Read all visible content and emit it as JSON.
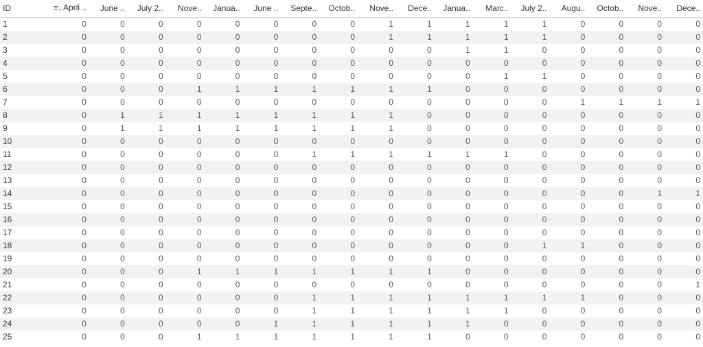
{
  "chart_data": {
    "type": "table",
    "title": "",
    "id_header": "ID",
    "columns": [
      "April ..",
      "June ..",
      "July 2..",
      "Nove..",
      "Janua..",
      "June ..",
      "Septe..",
      "Octob..",
      "Nove..",
      "Dece..",
      "Janua..",
      "Marc..",
      "July 2..",
      "Augu..",
      "Octob..",
      "Nove..",
      "Dece.."
    ],
    "sorted_column_index": 0,
    "rows": [
      {
        "id": "1",
        "values": [
          0,
          0,
          0,
          0,
          0,
          0,
          0,
          0,
          1,
          1,
          1,
          1,
          1,
          0,
          0,
          0,
          0
        ]
      },
      {
        "id": "2",
        "values": [
          0,
          0,
          0,
          0,
          0,
          0,
          0,
          0,
          1,
          1,
          1,
          1,
          1,
          0,
          0,
          0,
          0
        ]
      },
      {
        "id": "3",
        "values": [
          0,
          0,
          0,
          0,
          0,
          0,
          0,
          0,
          0,
          0,
          1,
          1,
          0,
          0,
          0,
          0,
          0
        ]
      },
      {
        "id": "4",
        "values": [
          0,
          0,
          0,
          0,
          0,
          0,
          0,
          0,
          0,
          0,
          0,
          0,
          0,
          0,
          0,
          0,
          0
        ]
      },
      {
        "id": "5",
        "values": [
          0,
          0,
          0,
          0,
          0,
          0,
          0,
          0,
          0,
          0,
          0,
          1,
          1,
          0,
          0,
          0,
          0
        ]
      },
      {
        "id": "6",
        "values": [
          0,
          0,
          0,
          1,
          1,
          1,
          1,
          1,
          1,
          1,
          0,
          0,
          0,
          0,
          0,
          0,
          0
        ]
      },
      {
        "id": "7",
        "values": [
          0,
          0,
          0,
          0,
          0,
          0,
          0,
          0,
          0,
          0,
          0,
          0,
          0,
          1,
          1,
          1,
          1
        ]
      },
      {
        "id": "8",
        "values": [
          0,
          1,
          1,
          1,
          1,
          1,
          1,
          1,
          1,
          0,
          0,
          0,
          0,
          0,
          0,
          0,
          0
        ]
      },
      {
        "id": "9",
        "values": [
          0,
          1,
          1,
          1,
          1,
          1,
          1,
          1,
          1,
          0,
          0,
          0,
          0,
          0,
          0,
          0,
          0
        ]
      },
      {
        "id": "10",
        "values": [
          0,
          0,
          0,
          0,
          0,
          0,
          0,
          0,
          0,
          0,
          0,
          0,
          0,
          0,
          0,
          0,
          0
        ]
      },
      {
        "id": "11",
        "values": [
          0,
          0,
          0,
          0,
          0,
          0,
          1,
          1,
          1,
          1,
          1,
          1,
          0,
          0,
          0,
          0,
          0
        ]
      },
      {
        "id": "12",
        "values": [
          0,
          0,
          0,
          0,
          0,
          0,
          0,
          0,
          0,
          0,
          0,
          0,
          0,
          0,
          0,
          0,
          0
        ]
      },
      {
        "id": "13",
        "values": [
          0,
          0,
          0,
          0,
          0,
          0,
          0,
          0,
          0,
          0,
          0,
          0,
          0,
          0,
          0,
          0,
          0
        ]
      },
      {
        "id": "14",
        "values": [
          0,
          0,
          0,
          0,
          0,
          0,
          0,
          0,
          0,
          0,
          0,
          0,
          0,
          0,
          0,
          1,
          1
        ]
      },
      {
        "id": "15",
        "values": [
          0,
          0,
          0,
          0,
          0,
          0,
          0,
          0,
          0,
          0,
          0,
          0,
          0,
          0,
          0,
          0,
          0
        ]
      },
      {
        "id": "16",
        "values": [
          0,
          0,
          0,
          0,
          0,
          0,
          0,
          0,
          0,
          0,
          0,
          0,
          0,
          0,
          0,
          0,
          0
        ]
      },
      {
        "id": "17",
        "values": [
          0,
          0,
          0,
          0,
          0,
          0,
          0,
          0,
          0,
          0,
          0,
          0,
          0,
          0,
          0,
          0,
          0
        ]
      },
      {
        "id": "18",
        "values": [
          0,
          0,
          0,
          0,
          0,
          0,
          0,
          0,
          0,
          0,
          0,
          0,
          1,
          1,
          0,
          0,
          0
        ]
      },
      {
        "id": "19",
        "values": [
          0,
          0,
          0,
          0,
          0,
          0,
          0,
          0,
          0,
          0,
          0,
          0,
          0,
          0,
          0,
          0,
          0
        ]
      },
      {
        "id": "20",
        "values": [
          0,
          0,
          0,
          1,
          1,
          1,
          1,
          1,
          1,
          1,
          0,
          0,
          0,
          0,
          0,
          0,
          0
        ]
      },
      {
        "id": "21",
        "values": [
          0,
          0,
          0,
          0,
          0,
          0,
          0,
          0,
          0,
          0,
          0,
          0,
          0,
          0,
          0,
          0,
          1
        ]
      },
      {
        "id": "22",
        "values": [
          0,
          0,
          0,
          0,
          0,
          0,
          1,
          1,
          1,
          1,
          1,
          1,
          1,
          1,
          0,
          0,
          0
        ]
      },
      {
        "id": "23",
        "values": [
          0,
          0,
          0,
          0,
          0,
          0,
          1,
          1,
          1,
          1,
          1,
          1,
          0,
          0,
          0,
          0,
          0
        ]
      },
      {
        "id": "24",
        "values": [
          0,
          0,
          0,
          0,
          0,
          1,
          1,
          1,
          1,
          1,
          1,
          0,
          0,
          0,
          0,
          0,
          0
        ]
      },
      {
        "id": "25",
        "values": [
          0,
          0,
          0,
          1,
          1,
          1,
          1,
          1,
          1,
          1,
          0,
          0,
          0,
          0,
          0,
          0,
          0
        ]
      }
    ]
  }
}
